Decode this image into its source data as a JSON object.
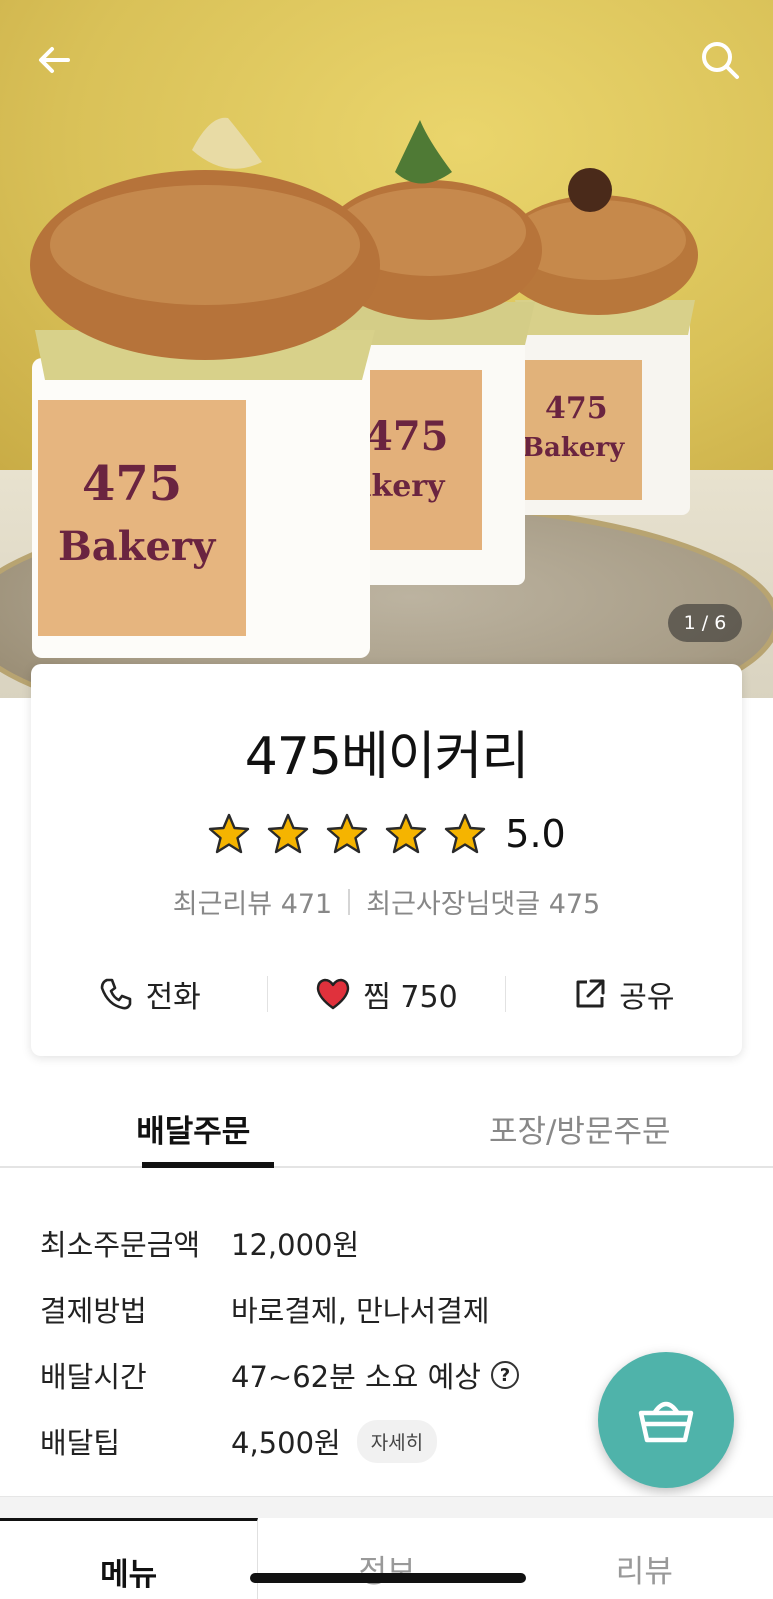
{
  "hero": {
    "page_indicator": "1 / 6",
    "cup_label_line1": "475",
    "cup_label_line2": "Bakery",
    "cup_label_line2_cropped": "akery"
  },
  "icons": {
    "back": "arrow-left-icon",
    "search": "search-icon",
    "star": "star-icon",
    "phone": "phone-icon",
    "heart": "heart-icon",
    "share": "share-icon",
    "help": "question-circle-icon",
    "cart": "basket-icon"
  },
  "store": {
    "name": "475베이커리",
    "rating": 5.0,
    "rating_text": "5.0",
    "recent_reviews": "최근리뷰 471",
    "recent_owner_replies": "최근사장님댓글 475"
  },
  "actions": {
    "call": "전화",
    "favorite": "찜 750",
    "share": "공유"
  },
  "order_tabs": [
    {
      "label": "배달주문",
      "active": true
    },
    {
      "label": "포장/방문주문",
      "active": false
    }
  ],
  "delivery_info": {
    "min_order_label": "최소주문금액",
    "min_order_value": "12,000원",
    "payment_label": "결제방법",
    "payment_value": "바로결제, 만나서결제",
    "time_label": "배달시간",
    "time_value": "47~62분 소요 예상",
    "help_glyph": "?",
    "tip_label": "배달팁",
    "tip_value": "4,500원",
    "tip_detail": "자세히"
  },
  "bottom_tabs": [
    {
      "label": "메뉴",
      "active": true
    },
    {
      "label": "정보",
      "active": false
    },
    {
      "label": "리뷰",
      "active": false
    }
  ],
  "colors": {
    "fab": "#4fb3aa",
    "star": "#f5b400",
    "heart": "#e0313c"
  }
}
